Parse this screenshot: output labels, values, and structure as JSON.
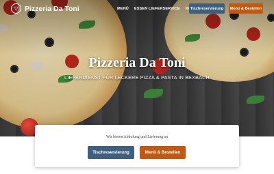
{
  "nav": {
    "brand": "Pizzeria Da Toni",
    "logo_icon": "pizza-slice-icon",
    "links": [
      {
        "label": "MENÜ"
      },
      {
        "label": "ESSEN LIEFERSERVICE"
      },
      {
        "label": "KONTAKT"
      }
    ],
    "reserve_label": "Tischreservierung",
    "order_label": "Menü & Bestellen"
  },
  "hero": {
    "title": "Pizzeria Da Toni",
    "subtitle": "LIEFERDIENST FÜR LECKERE PIZZA & PASTA IN BEXBACH"
  },
  "card": {
    "text": "Wir bieten Abholung und Lieferung an",
    "reserve_label": "Tischreservierung",
    "order_label": "Menü & Bestellen"
  },
  "colors": {
    "reserve_button": "#3f5f7f",
    "order_button": "#c3590f",
    "hero_background": "#3f3f3f"
  }
}
